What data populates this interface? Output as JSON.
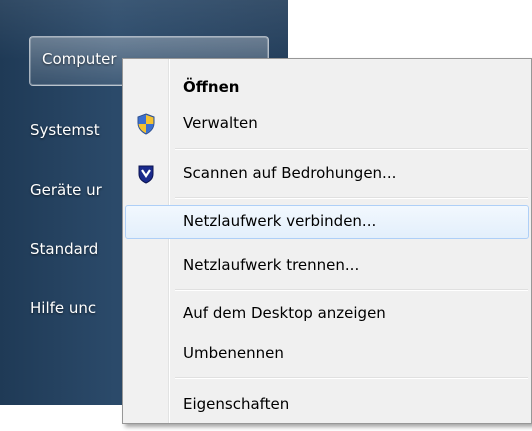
{
  "start_menu": {
    "items": [
      {
        "label": "Computer"
      },
      {
        "label": "Systemst"
      },
      {
        "label": "Geräte ur"
      },
      {
        "label": "Standard"
      },
      {
        "label": "Hilfe unc"
      }
    ]
  },
  "context_menu": {
    "items": [
      {
        "label": "Öffnen",
        "bold": true
      },
      {
        "label": "Verwalten",
        "icon": "uac-shield-icon"
      },
      {
        "label": "Scannen auf Bedrohungen...",
        "icon": "antivirus-shield-icon"
      },
      {
        "label": "Netzlaufwerk verbinden...",
        "hovered": true
      },
      {
        "label": "Netzlaufwerk trennen..."
      },
      {
        "label": "Auf dem Desktop anzeigen"
      },
      {
        "label": "Umbenennen"
      },
      {
        "label": "Eigenschaften"
      }
    ]
  },
  "colors": {
    "start_pane": "#243f5c",
    "menu_background": "#f0f0f0",
    "hover_border": "#aecff7"
  }
}
